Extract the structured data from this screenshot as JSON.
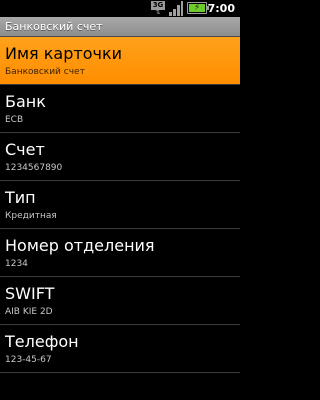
{
  "status_bar": {
    "network_badge": "3G",
    "time": "7:00",
    "icons": {
      "network": "3g-icon",
      "signal": "signal-strength-icon",
      "battery": "battery-charging-icon"
    },
    "battery_color": "#6ecb2c"
  },
  "title_bar": {
    "title": "Банковский счет"
  },
  "list": {
    "selected_color": "#ff9500",
    "items": [
      {
        "title": "Имя карточки",
        "value": "Банковский счет"
      },
      {
        "title": "Банк",
        "value": "ECB"
      },
      {
        "title": "Счет",
        "value": "1234567890"
      },
      {
        "title": "Тип",
        "value": "Кредитная"
      },
      {
        "title": "Номер отделения",
        "value": "1234"
      },
      {
        "title": "SWIFT",
        "value": "AIB KIE 2D"
      },
      {
        "title": "Телефон",
        "value": "123-45-67"
      }
    ]
  }
}
